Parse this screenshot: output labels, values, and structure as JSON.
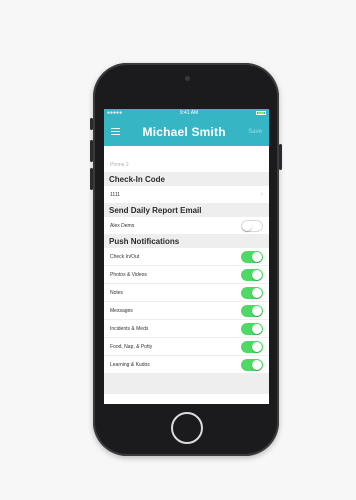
{
  "status_bar": {
    "signal": "●●●●● ",
    "time": "9:41 AM"
  },
  "nav": {
    "title": "Michael Smith",
    "save_label": "Save"
  },
  "phone2": {
    "placeholder": "Phone 2"
  },
  "checkin": {
    "header": "Check-In Code",
    "value": "1111"
  },
  "daily_report": {
    "header": "Send Daily Report Email",
    "name": "Alex Demo",
    "enabled": false
  },
  "push": {
    "header": "Push Notifications",
    "items": [
      {
        "label": "Check In/Out",
        "enabled": true
      },
      {
        "label": "Photos & Videos",
        "enabled": true
      },
      {
        "label": "Notes",
        "enabled": true
      },
      {
        "label": "Messages",
        "enabled": true
      },
      {
        "label": "Incidents & Meds",
        "enabled": true
      },
      {
        "label": "Food, Nap, & Potty",
        "enabled": true
      },
      {
        "label": "Learning & Kudos",
        "enabled": true
      }
    ]
  },
  "colors": {
    "accent": "#36b6c5",
    "toggle_on": "#4cd964",
    "section_bg": "#eeeeee"
  }
}
